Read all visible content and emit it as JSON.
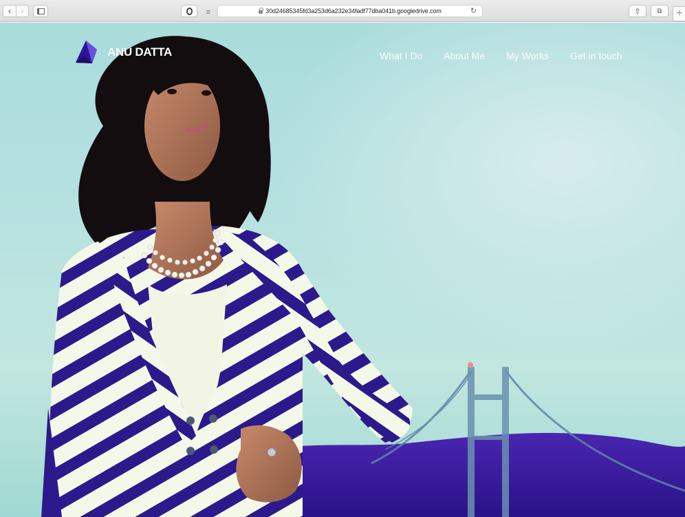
{
  "browser": {
    "url": "30d24685345fd3a253d6a232e34fadf77dba041b.googledrive.com",
    "back_icon": "chevron-left-icon",
    "forward_icon": "chevron-right-icon",
    "sidebar_icon": "sidebar-icon",
    "opera_icon": "opera-icon",
    "reader_icon": "reader-icon",
    "reload_icon": "reload-icon",
    "share_icon": "share-icon",
    "tabs_icon": "tabs-icon",
    "new_tab_icon": "plus-icon"
  },
  "site": {
    "brand_name": "ANU DATTA",
    "logo_icon": "gem-logo-icon",
    "nav": [
      "What I Do",
      "About Me",
      "My Works",
      "Get in touch"
    ]
  },
  "colors": {
    "sky": "#b8e2e0",
    "stripe_navy": "#2c1a8c",
    "stripe_cream": "#f4f8e8",
    "hill": "#3b1aa0",
    "nav_text": "#ffffff"
  }
}
